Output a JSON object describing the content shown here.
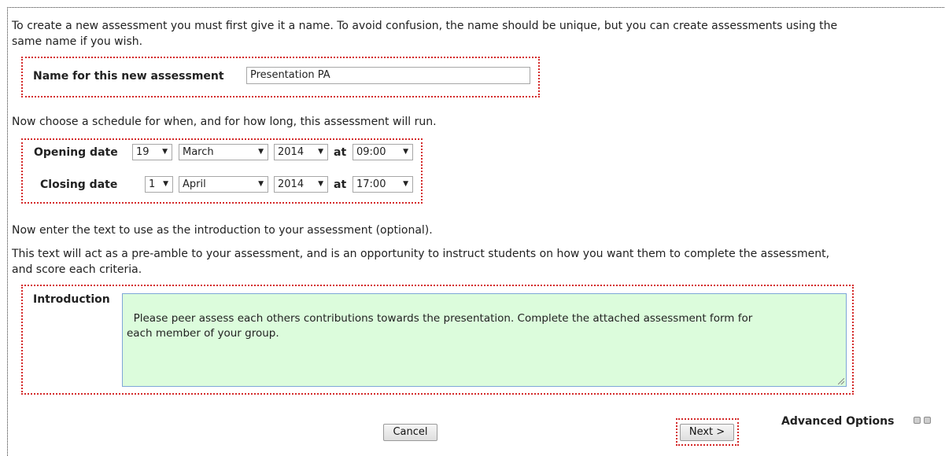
{
  "intro": {
    "line1": "To create a new assessment you must first give it a name. To avoid confusion, the name should be unique, but you can create assessments using the",
    "line2": "same name if you wish."
  },
  "name_field": {
    "label": "Name for this new assessment",
    "value": "Presentation PA"
  },
  "schedule": {
    "text": "Now choose a schedule for when, and for how long, this assessment will run.",
    "at_label": "at",
    "opening": {
      "label": "Opening date",
      "day": "19",
      "month": "March",
      "year": "2014",
      "time": "09:00"
    },
    "closing": {
      "label": "Closing date",
      "day": "1",
      "month": "April",
      "year": "2014",
      "time": "17:00"
    }
  },
  "introduction": {
    "text1": "Now enter the text to use as the introduction to your assessment (optional).",
    "text2_line1": "This text will act as a pre-amble to your assessment, and is an opportunity to instruct students on how you want them to complete the assessment,",
    "text2_line2": "and score each criteria.",
    "label": "Introduction",
    "value": "Please peer assess each others contributions towards the presentation. Complete the attached assessment form for\neach member of your group."
  },
  "buttons": {
    "cancel": "Cancel",
    "next": "Next >"
  },
  "advanced": {
    "label": "Advanced Options",
    "colors": {
      "highlight_border": "#d42a2a",
      "textarea_bg": "#dcfcdc"
    }
  },
  "icons": {
    "dropdown": "▼"
  }
}
